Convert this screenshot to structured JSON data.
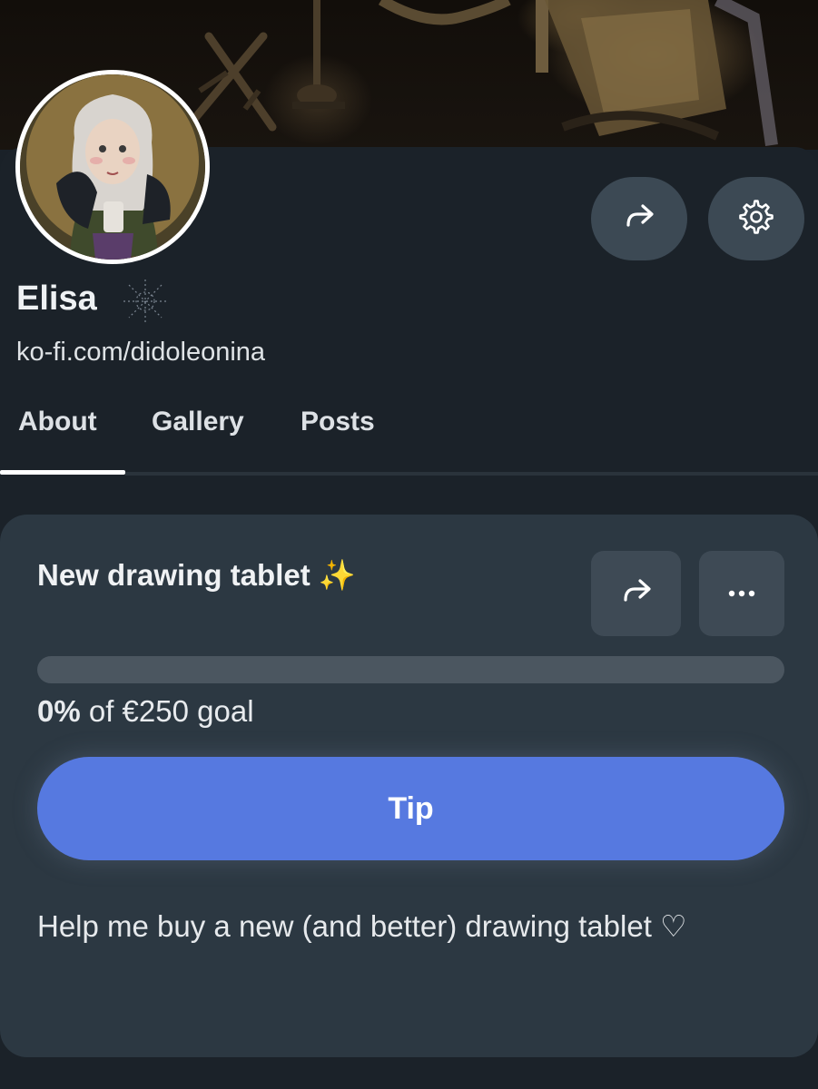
{
  "profile": {
    "name": "Elisa",
    "url": "ko-fi.com/didoleonina"
  },
  "tabs": [
    {
      "label": "About",
      "active": true
    },
    {
      "label": "Gallery",
      "active": false
    },
    {
      "label": "Posts",
      "active": false
    }
  ],
  "goal": {
    "title": "New drawing tablet ✨",
    "percent": "0%",
    "goal_suffix": " of €250 goal",
    "progress_fraction": 0,
    "tip_label": "Tip",
    "description": "Help me buy a new (and better) drawing tablet ♡"
  },
  "icons": {
    "share": "share-icon",
    "settings": "gear-icon",
    "more": "more-icon",
    "badge": "sparkle-badge-icon"
  },
  "colors": {
    "accent": "#5679e0",
    "background": "#1b2229",
    "card": "#2c3842"
  }
}
